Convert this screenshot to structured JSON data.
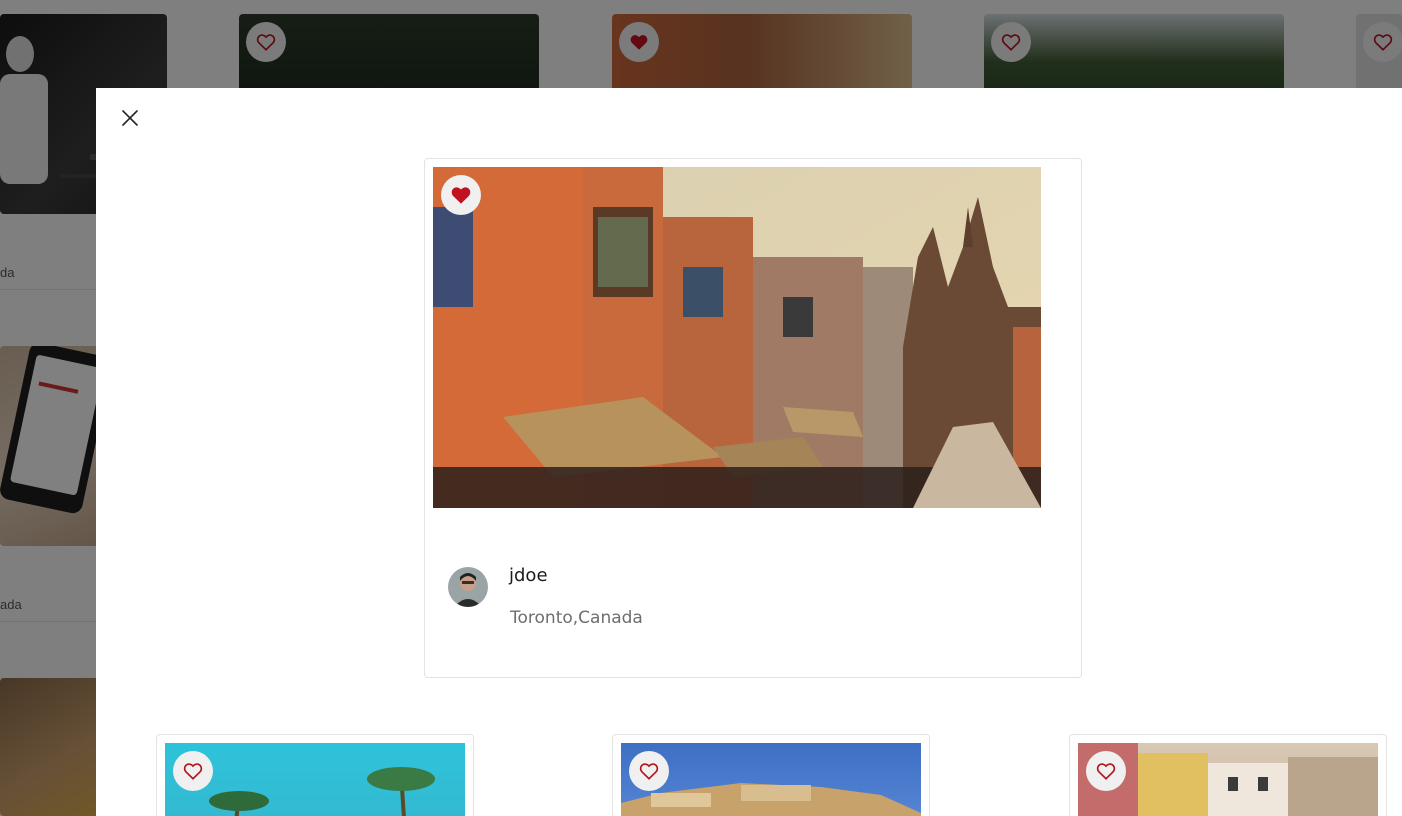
{
  "gallery_background": {
    "location_snippets": [
      "da",
      "ada"
    ]
  },
  "modal": {
    "close_icon": "close-icon",
    "post": {
      "liked": true,
      "photo_description": "",
      "author": {
        "username": "jdoe",
        "location": "Toronto,Canada"
      }
    },
    "related_posts": [
      {
        "liked": false
      },
      {
        "liked": false
      },
      {
        "liked": false
      }
    ]
  },
  "colors": {
    "heart_filled": "#c1121f",
    "heart_outline": "#b0141c",
    "heart_button_bg": "#f0f0f0"
  }
}
